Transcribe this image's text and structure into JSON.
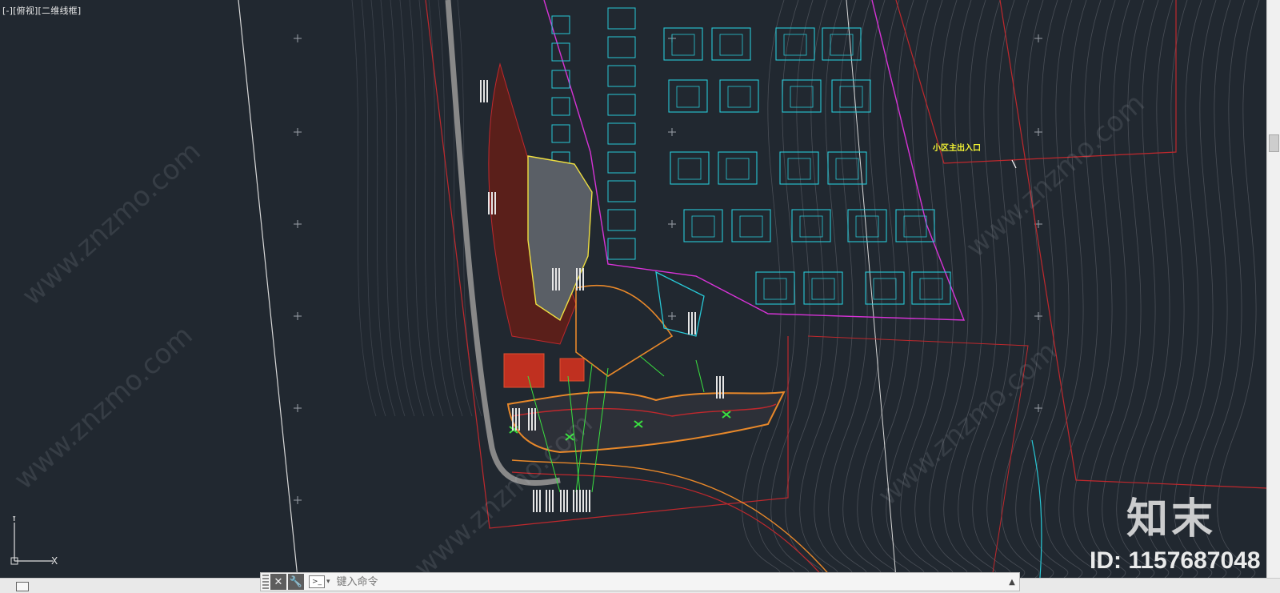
{
  "viewport": {
    "view_controls": [
      "[-]",
      "[俯视]",
      "[二维线框]"
    ],
    "annotation": "小区主出入口",
    "ucs": {
      "x_label": "X",
      "y_label": "Y"
    },
    "colors": {
      "background": "#212830",
      "boundary_red": "#c0282d",
      "boundary_magenta": "#d633d6",
      "buildings_cyan": "#28c8d6",
      "paving_orange": "#e8882a",
      "planting_green": "#3ae040",
      "annotation_yellow": "#f5f534"
    }
  },
  "watermark": {
    "brand": "知末",
    "id_text": "ID: 1157687048",
    "diagonal_text": "www.znzmo.com"
  },
  "command_line": {
    "placeholder": "键入命令",
    "close_icon": "close-icon",
    "customize_icon": "wrench-icon"
  }
}
